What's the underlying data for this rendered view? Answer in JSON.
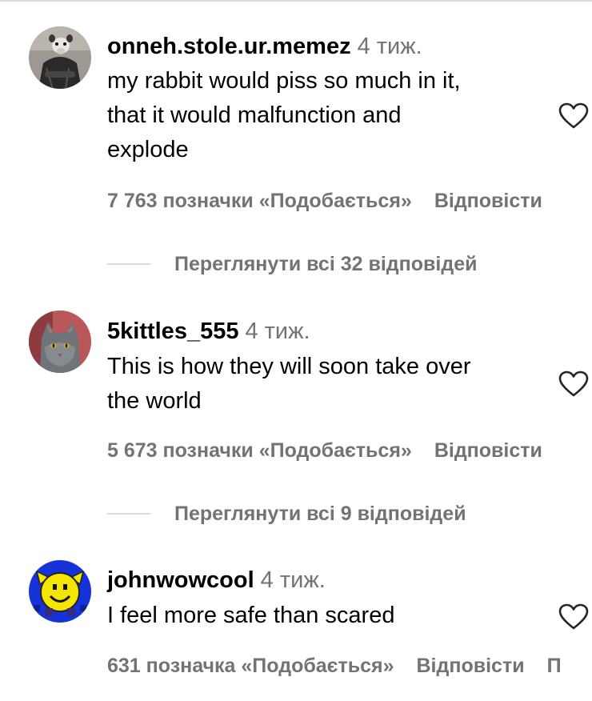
{
  "comments": [
    {
      "username": "onneh.stole.ur.memez",
      "time": "4 тиж.",
      "lines": [
        "my rabbit would piss so much in it,",
        "that it would malfunction and",
        "explode"
      ],
      "likes": "7 763 позначки «Подобається»",
      "reply": "Відповісти",
      "view_replies": "Переглянути всі 32 відповідей",
      "avatar_icon": "opossum-avatar"
    },
    {
      "username": "5kittles_555",
      "time": "4 тиж.",
      "lines": [
        "This is how they will soon take over",
        "the world"
      ],
      "likes": "5 673 позначки «Подобається»",
      "reply": "Відповісти",
      "view_replies": "Переглянути всі 9 відповідей",
      "avatar_icon": "cat-avatar"
    },
    {
      "username": "johnwowcool",
      "time": "4 тиж.",
      "lines": [
        "I feel more safe than scared"
      ],
      "likes": "631 позначка «Подобається»",
      "reply": "Відповісти",
      "extra": "П",
      "avatar_icon": "smiley-avatar"
    }
  ],
  "icons": {
    "like": "heart-outline-icon"
  },
  "colors": {
    "primary_text": "#000000",
    "secondary_text": "#737373",
    "divider": "#dbdbdb",
    "smiley_background": "#1533d8",
    "smiley_face": "#f5e600"
  }
}
